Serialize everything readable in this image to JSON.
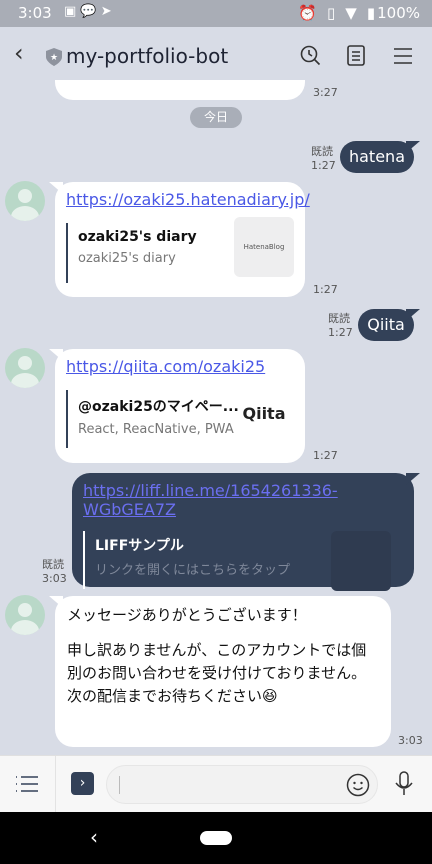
{
  "status_bar": {
    "time": "3:03",
    "battery": "100%",
    "icons": [
      "image-icon",
      "line-icon",
      "play-icon",
      "alarm-icon",
      "vibrate-icon",
      "wifi-icon",
      "battery-icon"
    ]
  },
  "header": {
    "title": "my-portfolio-bot",
    "icons": [
      "back-icon",
      "verified-shield-icon",
      "search-history-icon",
      "notes-icon",
      "menu-icon"
    ]
  },
  "chat": {
    "prev_time": "3:27",
    "date_label": "今日",
    "messages": [
      {
        "side": "right",
        "text": "hatena",
        "read": "既読",
        "time": "1:27"
      },
      {
        "side": "left",
        "link": "https://ozaki25.hatenadiary.jp/",
        "card_title": "ozaki25's diary",
        "card_sub": "ozaki25's diary",
        "thumb": "HatenaBlog",
        "time": "1:27"
      },
      {
        "side": "right",
        "text": "Qiita",
        "read": "既読",
        "time": "1:27"
      },
      {
        "side": "left",
        "link": "https://qiita.com/ozaki25",
        "card_title": "@ozaki25のマイペー...",
        "card_sub": "React, ReacNative, PWA",
        "thumb": "Qiita",
        "time": "1:27"
      },
      {
        "side": "right",
        "link": "https://liff.line.me/1654261336-WGbGEA7Z",
        "card_title": "LIFFサンプル",
        "card_sub": "リンクを開くにはこちらをタップ",
        "read": "既読",
        "time": "3:03"
      },
      {
        "side": "left",
        "lines": [
          "メッセージありがとうございます！",
          "",
          "申し訳ありませんが、このアカウントでは個別のお問い合わせを受け付けておりません。",
          "次の配信までお待ちください😆"
        ],
        "time": "3:03"
      }
    ]
  },
  "input": {
    "placeholder": "",
    "icons": [
      "menu-list-icon",
      "expand-icon",
      "emoji-icon",
      "microphone-icon"
    ]
  },
  "colors": {
    "background": "#d8dce6",
    "own_bubble": "#334158",
    "link": "#4a58e6"
  }
}
